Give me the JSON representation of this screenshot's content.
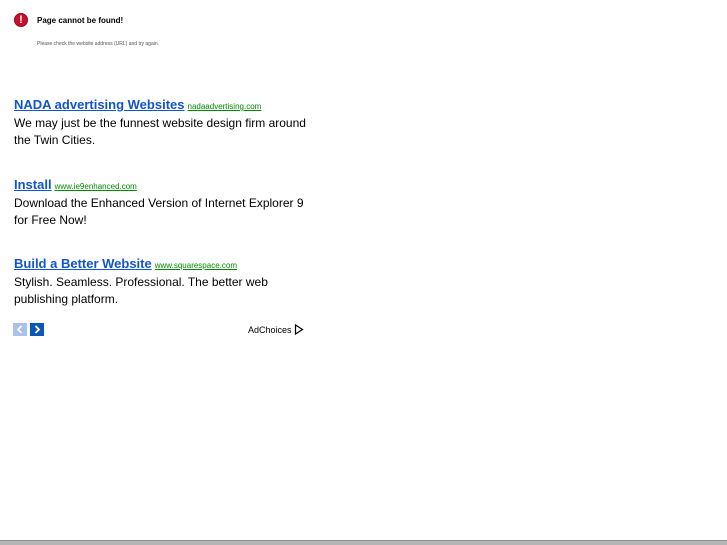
{
  "error": {
    "icon": "error-icon",
    "glyph": "!",
    "title": "Page cannot be found!",
    "detail": "Please check the website address (URL) and try again."
  },
  "ads": [
    {
      "title": "NADA advertising Websites",
      "url": "nadaadvertising.com",
      "description": "We may just be the funnest website design firm around the Twin Cities."
    },
    {
      "title": "Install",
      "url": "www.ie9enhanced.com",
      "description": "Download the Enhanced Version of Internet Explorer 9 for Free Now!"
    },
    {
      "title": "Build a Better Website",
      "url": "www.squarespace.com",
      "description": "Stylish. Seamless. Professional. The better web publishing platform."
    }
  ],
  "nav": {
    "prev_icon": "chevron-left-icon",
    "next_icon": "chevron-right-icon"
  },
  "adchoices": {
    "label": "AdChoices",
    "icon": "adchoices-icon"
  },
  "colors": {
    "error_red": "#c8102e",
    "link_blue": "#1155cc",
    "url_green": "#008a00",
    "nav_prev": "#a9c1ec",
    "nav_next": "#0b57b8"
  }
}
